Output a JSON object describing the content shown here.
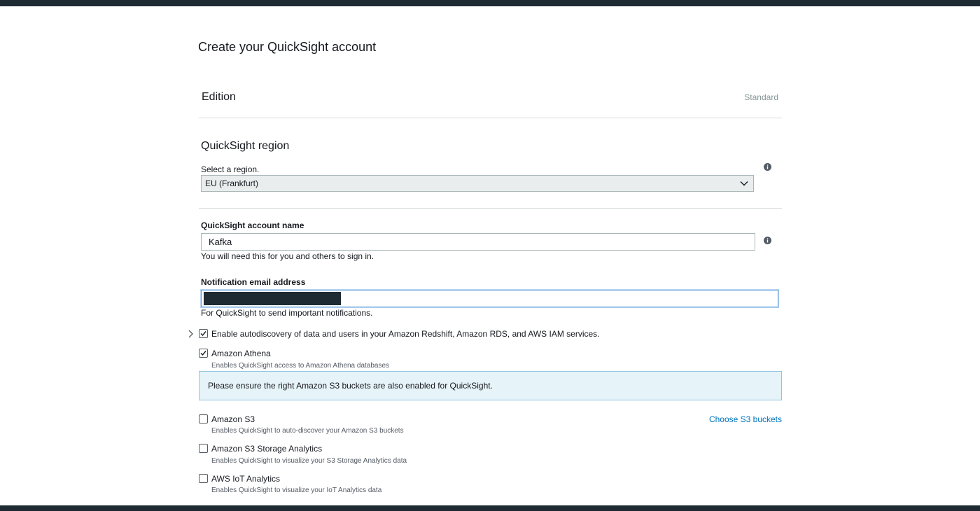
{
  "page": {
    "title": "Create your QuickSight account"
  },
  "edition": {
    "label": "Edition",
    "value": "Standard"
  },
  "region": {
    "title": "QuickSight region",
    "select_label": "Select a region.",
    "selected": "EU (Frankfurt)"
  },
  "account": {
    "label": "QuickSight account name",
    "value": "Kafka",
    "hint": "You will need this for you and others to sign in."
  },
  "email": {
    "label": "Notification email address",
    "hint": "For QuickSight to send important notifications."
  },
  "autodiscovery": {
    "label": "Enable autodiscovery of data and users in your Amazon Redshift, Amazon RDS, and AWS IAM services.",
    "checked": true
  },
  "services": [
    {
      "label": "Amazon Athena",
      "desc": "Enables QuickSight access to Amazon Athena databases",
      "checked": true
    },
    {
      "label": "Amazon S3",
      "desc": "Enables QuickSight to auto-discover your Amazon S3 buckets",
      "checked": false
    },
    {
      "label": "Amazon S3 Storage Analytics",
      "desc": "Enables QuickSight to visualize your S3 Storage Analytics data",
      "checked": false
    },
    {
      "label": "AWS IoT Analytics",
      "desc": "Enables QuickSight to visualize your IoT Analytics data",
      "checked": false
    }
  ],
  "alert": {
    "text": "Please ensure the right Amazon S3 buckets are also enabled for QuickSight."
  },
  "s3_link": {
    "label": "Choose S3 buckets"
  },
  "colors": {
    "link": "#0073bb",
    "alert_bg": "#e6f3f8",
    "header_bar": "#1e2b33"
  }
}
